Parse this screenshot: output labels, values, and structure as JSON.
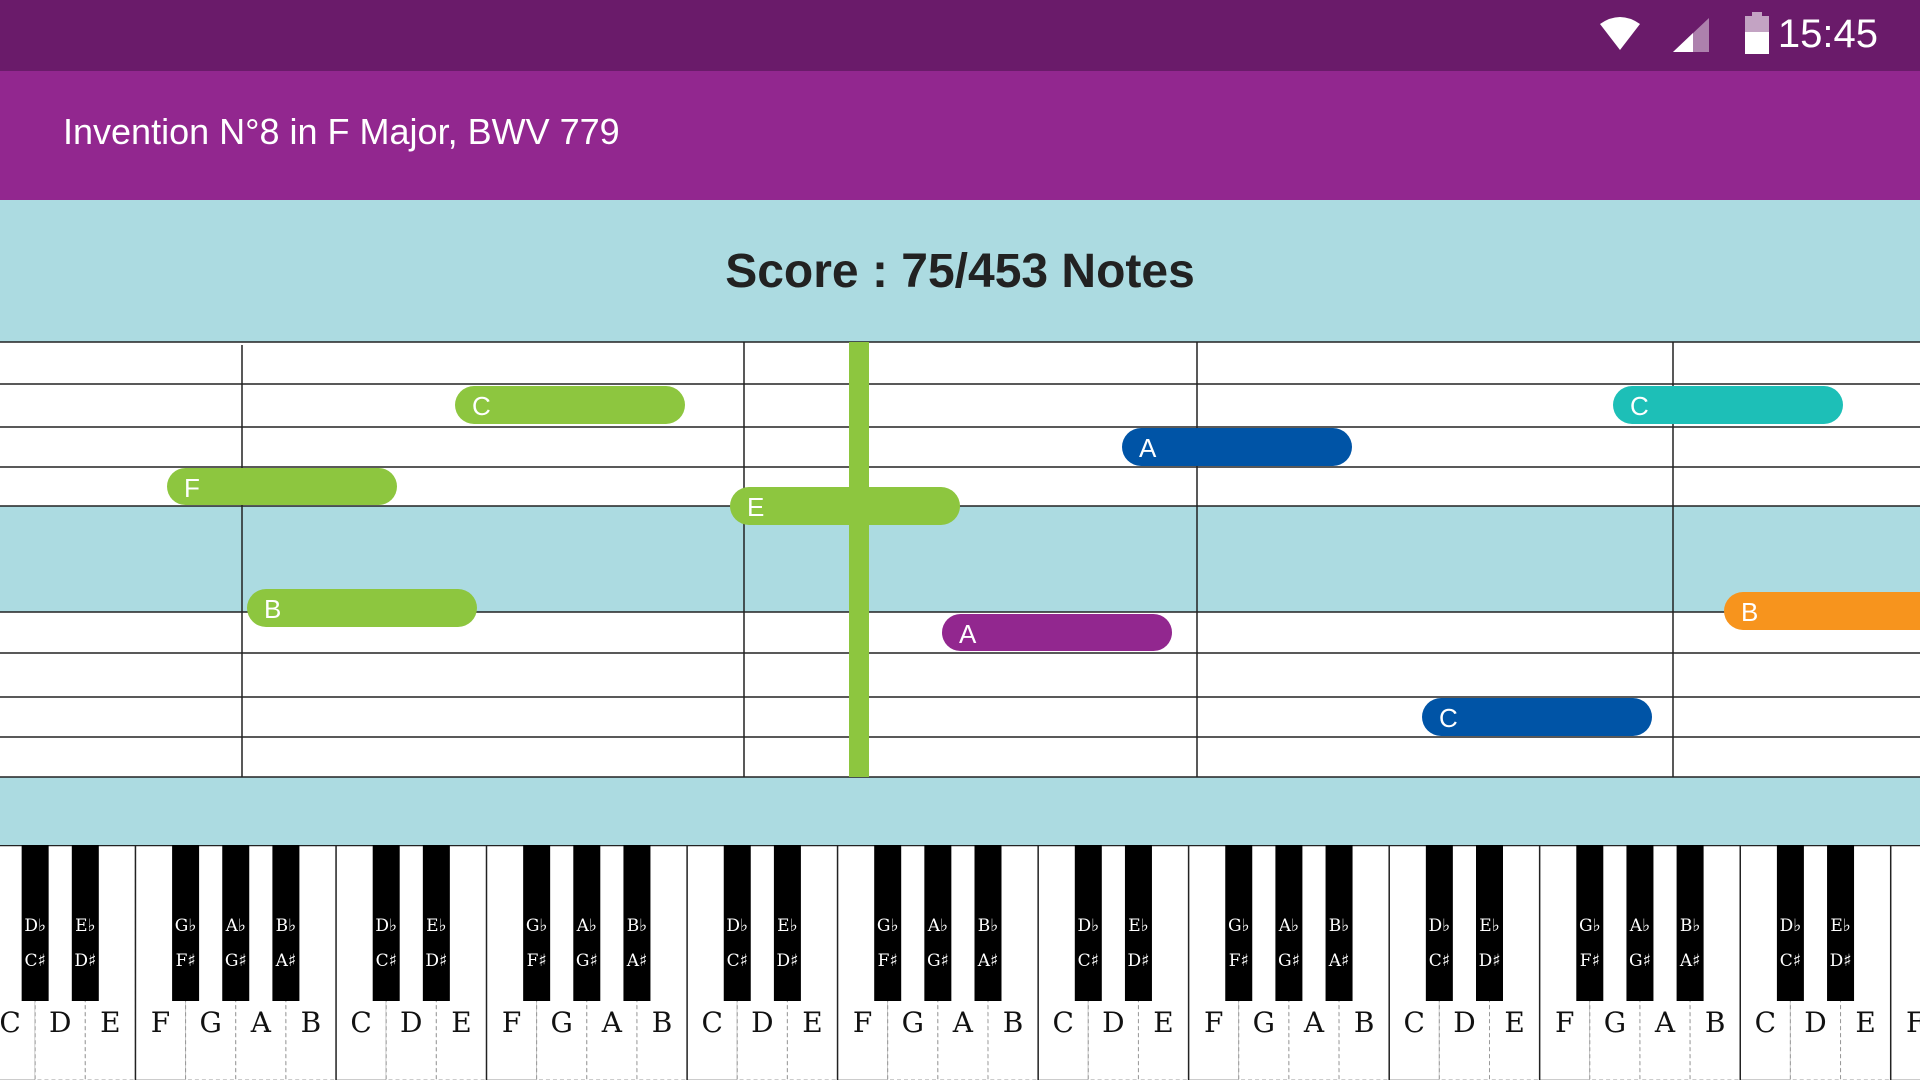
{
  "status_bar": {
    "time": "15:45",
    "icons": [
      "wifi-icon",
      "cellular-signal-icon",
      "battery-icon"
    ]
  },
  "app_bar": {
    "title": "Invention N°8 in F Major, BWV 779"
  },
  "score": {
    "text": "Score : 75/453 Notes"
  },
  "colors": {
    "status_bar": "#6a1b6a",
    "app_bar": "#92278f",
    "band": "#acdbe1",
    "cursor": "#8dc63f",
    "green": "#8dc63f",
    "blue": "#0054a6",
    "teal": "#1dbfb7",
    "purple": "#92278f",
    "orange": "#f7941d"
  },
  "notes": [
    {
      "label": "F",
      "color": "green"
    },
    {
      "label": "C",
      "color": "green"
    },
    {
      "label": "B",
      "color": "green"
    },
    {
      "label": "E",
      "color": "green"
    },
    {
      "label": "A",
      "color": "purple"
    },
    {
      "label": "A",
      "color": "blue"
    },
    {
      "label": "C",
      "color": "blue"
    },
    {
      "label": "C",
      "color": "teal"
    },
    {
      "label": "B",
      "color": "orange"
    }
  ],
  "keyboard": {
    "white_keys": [
      "C",
      "D",
      "E",
      "F",
      "G",
      "A",
      "B",
      "C",
      "D",
      "E",
      "F",
      "G",
      "A",
      "B",
      "C",
      "D",
      "E",
      "F",
      "G",
      "A",
      "B",
      "C",
      "D",
      "E",
      "F",
      "G",
      "A",
      "B",
      "C",
      "D",
      "E",
      "F",
      "G",
      "A",
      "B",
      "C",
      "D",
      "E",
      "F"
    ],
    "black_keys": [
      {
        "top": "D♭",
        "bottom": "C♯"
      },
      {
        "top": "E♭",
        "bottom": "D♯"
      },
      {
        "top": "G♭",
        "bottom": "F♯"
      },
      {
        "top": "A♭",
        "bottom": "G♯"
      },
      {
        "top": "B♭",
        "bottom": "A♯"
      }
    ]
  }
}
